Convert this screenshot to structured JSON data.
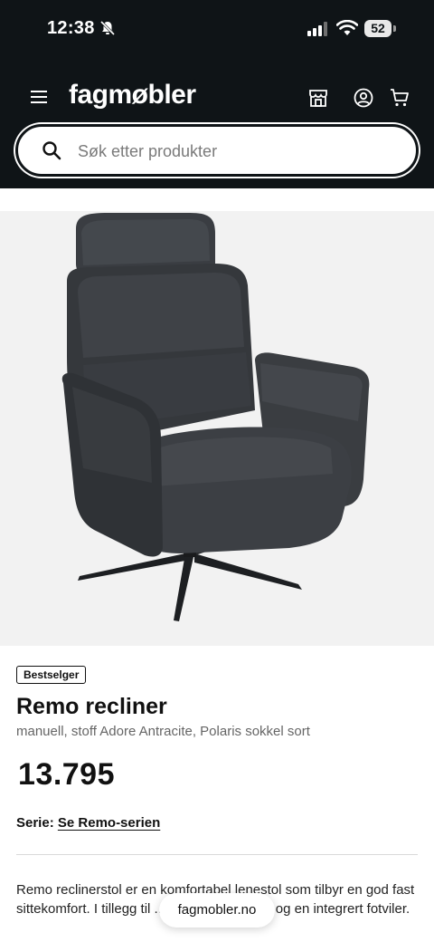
{
  "status_bar": {
    "time": "12:38",
    "battery": "52",
    "icons": [
      "bell-slash-icon",
      "cellular-signal-icon",
      "wifi-icon",
      "battery-icon"
    ]
  },
  "header": {
    "logo": "fagmøbler",
    "icons": [
      "hamburger-menu-icon",
      "store-icon",
      "account-icon",
      "cart-icon"
    ]
  },
  "search": {
    "placeholder": "Søk etter produkter",
    "icon": "search-icon"
  },
  "product": {
    "badge": "Bestselger",
    "title": "Remo recliner",
    "subtitle": "manuell, stoff Adore Antracite, Polaris sokkel sort",
    "price": "13.795",
    "series_label": "Serie:",
    "series_link": "Se Remo-serien",
    "description": "Remo reclinerstol er en komfortabel lenestol som tilbyr en god fast sittekomfort. I tillegg til ... isk svingfunksjon og en integrert fotviler."
  },
  "browser": {
    "url": "fagmobler.no"
  },
  "colors": {
    "header_bg": "#0f1417",
    "image_bg": "#f2f2f2",
    "text": "#111111"
  }
}
